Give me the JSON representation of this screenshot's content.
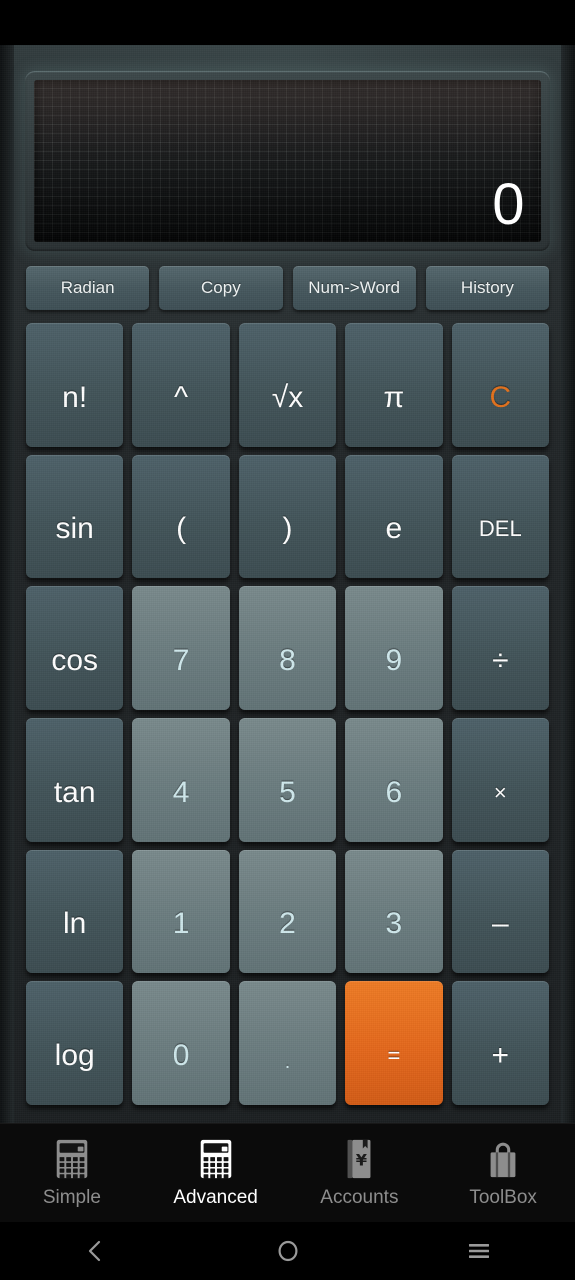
{
  "display": {
    "value": "0"
  },
  "toolbar": {
    "buttons": [
      {
        "label": "Radian",
        "name": "radian-button"
      },
      {
        "label": "Copy",
        "name": "copy-button"
      },
      {
        "label": "Num->Word",
        "name": "num-to-word-button"
      },
      {
        "label": "History",
        "name": "history-button"
      }
    ]
  },
  "keypad": {
    "rows": [
      [
        {
          "label": "n!",
          "type": "fn"
        },
        {
          "label": "^",
          "type": "fn"
        },
        {
          "label": "√x",
          "type": "fn"
        },
        {
          "label": "π",
          "type": "fn"
        },
        {
          "label": "C",
          "type": "fn-accent"
        }
      ],
      [
        {
          "label": "sin",
          "type": "fn"
        },
        {
          "label": "(",
          "type": "fn"
        },
        {
          "label": ")",
          "type": "fn"
        },
        {
          "label": "e",
          "type": "fn"
        },
        {
          "label": "DEL",
          "type": "fn-small"
        }
      ],
      [
        {
          "label": "cos",
          "type": "fn"
        },
        {
          "label": "7",
          "type": "num"
        },
        {
          "label": "8",
          "type": "num"
        },
        {
          "label": "9",
          "type": "num"
        },
        {
          "label": "÷",
          "type": "fn"
        }
      ],
      [
        {
          "label": "tan",
          "type": "fn"
        },
        {
          "label": "4",
          "type": "num"
        },
        {
          "label": "5",
          "type": "num"
        },
        {
          "label": "6",
          "type": "num"
        },
        {
          "label": "×",
          "type": "fn-small"
        }
      ],
      [
        {
          "label": "ln",
          "type": "fn"
        },
        {
          "label": "1",
          "type": "num"
        },
        {
          "label": "2",
          "type": "num"
        },
        {
          "label": "3",
          "type": "num"
        },
        {
          "label": "–",
          "type": "fn"
        }
      ],
      [
        {
          "label": "log",
          "type": "fn"
        },
        {
          "label": "0",
          "type": "num"
        },
        {
          "label": ".",
          "type": "num-dot"
        },
        {
          "label": "=",
          "type": "equals"
        },
        {
          "label": "+",
          "type": "fn"
        }
      ]
    ]
  },
  "tabs": [
    {
      "label": "Simple",
      "icon": "calculator-icon",
      "active": false
    },
    {
      "label": "Advanced",
      "icon": "calculator-icon",
      "active": true
    },
    {
      "label": "Accounts",
      "icon": "ledger-yen-icon",
      "active": false
    },
    {
      "label": "ToolBox",
      "icon": "toolbox-icon",
      "active": false
    }
  ],
  "navbar": [
    {
      "name": "back-icon"
    },
    {
      "name": "home-icon"
    },
    {
      "name": "menu-icon"
    }
  ],
  "colors": {
    "accent_orange": "#e2711d",
    "equals_orange": "#e4681c",
    "function_key": "#425459",
    "number_key": "#6c7d80",
    "number_text": "#cfe8ec",
    "display_text": "#ffffff"
  }
}
